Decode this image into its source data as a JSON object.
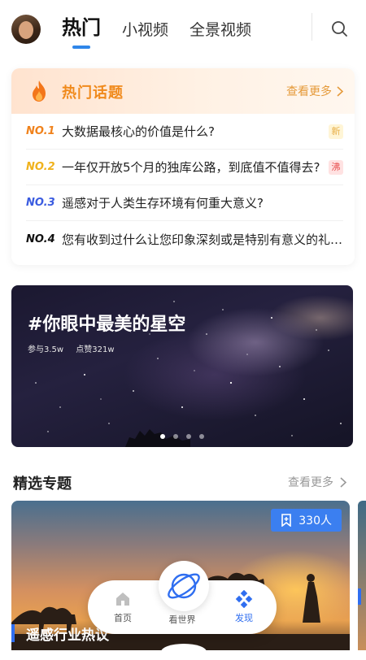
{
  "header": {
    "tabs": [
      {
        "label": "热门",
        "active": true
      },
      {
        "label": "小视频",
        "active": false
      },
      {
        "label": "全景视频",
        "active": false
      }
    ],
    "accent_color": "#2f86e9"
  },
  "hot_topics": {
    "title": "热门话题",
    "more_label": "查看更多",
    "items": [
      {
        "rank": "NO.1",
        "text": "大数据最核心的价值是什么?",
        "badge": "新"
      },
      {
        "rank": "NO.2",
        "text": "一年仅开放5个月的独库公路，到底值不值得去?",
        "badge": "沸"
      },
      {
        "rank": "NO.3",
        "text": "遥感对于人类生存环境有何重大意义?",
        "badge": ""
      },
      {
        "rank": "NO.4",
        "text": "您有收到过什么让您印象深刻或是特别有意义的礼物?",
        "badge": ""
      }
    ]
  },
  "banner": {
    "title": "#你眼中最美的星空",
    "participants": "参与3.5w",
    "likes": "点赞321w",
    "dot_count": 4,
    "active_dot": 0
  },
  "featured": {
    "title": "精选专题",
    "more_label": "查看更多",
    "card": {
      "count_label": "330人",
      "title": "遥感行业热议"
    }
  },
  "bottom_nav": {
    "items": [
      {
        "label": "首页",
        "icon": "home-icon",
        "active": false
      },
      {
        "label": "看世界",
        "icon": "planet-icon",
        "active": false
      },
      {
        "label": "发现",
        "icon": "discover-icon",
        "active": true
      }
    ],
    "active_color": "#2f6ef0"
  }
}
